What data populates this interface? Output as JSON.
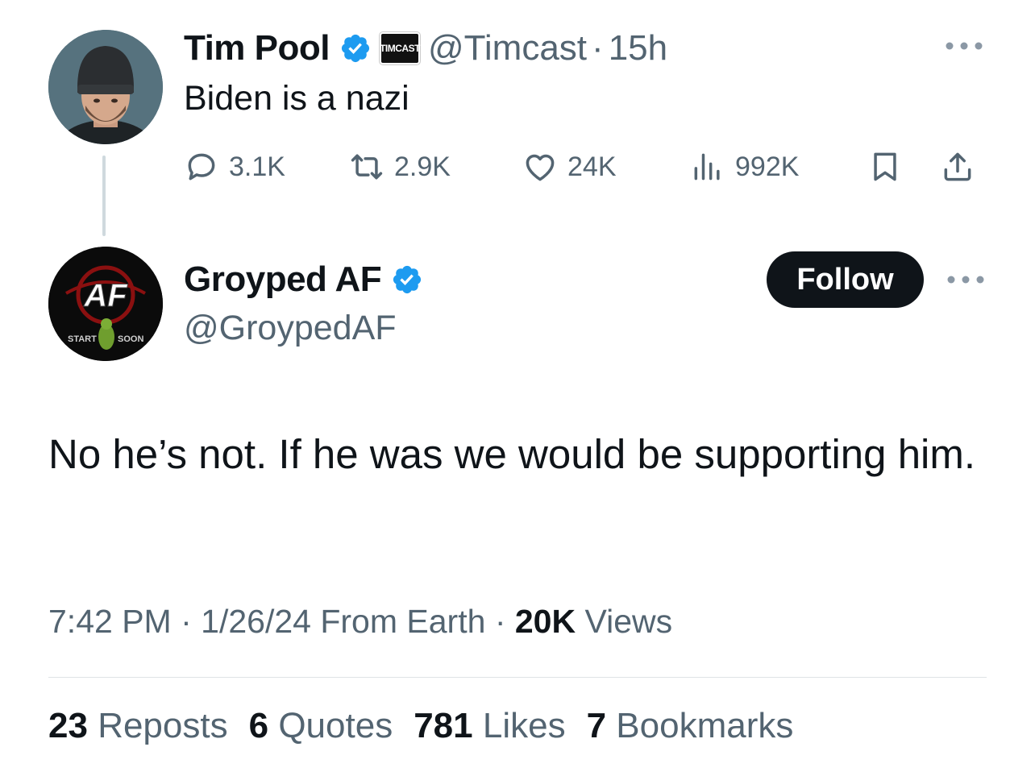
{
  "parent_tweet": {
    "author_name": "Tim Pool",
    "affiliate_label": "TIMCAST",
    "handle": "@Timcast",
    "time": "15h",
    "text": "Biden is a nazi",
    "replies": "3.1K",
    "reposts": "2.9K",
    "likes": "24K",
    "views": "992K"
  },
  "main_tweet": {
    "author_name": "Groyped AF",
    "handle": "@GroypedAF",
    "follow_label": "Follow",
    "avatar_logo_text": "AF",
    "avatar_left_text": "START",
    "avatar_right_text": "SOON",
    "text": "No he’s not. If he was we would be supporting him.",
    "time": "7:42 PM",
    "date": "1/26/24",
    "source": "From Earth",
    "views_count": "20K",
    "views_label": "Views",
    "reposts_count": "23",
    "reposts_label": "Reposts",
    "quotes_count": "6",
    "quotes_label": "Quotes",
    "likes_count": "781",
    "likes_label": "Likes",
    "bookmarks_count": "7",
    "bookmarks_label": "Bookmarks"
  },
  "colors": {
    "verified_blue": "#1d9bf0",
    "secondary_text": "#536471",
    "primary_text": "#0f1419",
    "thread_line": "#cfd9de"
  }
}
